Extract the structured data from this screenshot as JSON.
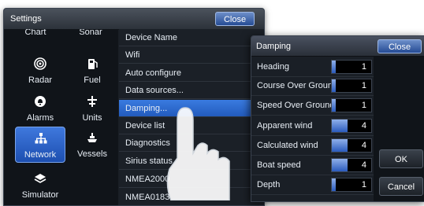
{
  "settings": {
    "title": "Settings",
    "close_label": "Close",
    "categories": [
      {
        "label": "Chart",
        "icon": "chart-icon"
      },
      {
        "label": "Sonar",
        "icon": "sonar-icon"
      },
      {
        "label": "Radar",
        "icon": "radar-icon"
      },
      {
        "label": "Fuel",
        "icon": "fuel-icon"
      },
      {
        "label": "Alarms",
        "icon": "alarms-icon"
      },
      {
        "label": "Units",
        "icon": "units-icon"
      },
      {
        "label": "Network",
        "icon": "network-icon",
        "selected": true
      },
      {
        "label": "Vessels",
        "icon": "vessels-icon"
      },
      {
        "label": "Simulator",
        "icon": "simulator-icon"
      }
    ],
    "items": [
      "Device Name",
      "Wifi",
      "Auto configure",
      "Data sources...",
      "Damping...",
      "Device list",
      "Diagnostics",
      "Sirius status",
      "NMEA2000",
      "NMEA0183"
    ],
    "selected_item": "Damping..."
  },
  "damping": {
    "title": "Damping",
    "close_label": "Close",
    "rows": [
      {
        "label": "Heading",
        "value": "1",
        "level": 1
      },
      {
        "label": "Course Over Ground",
        "value": "1",
        "level": 1
      },
      {
        "label": "Speed Over Ground",
        "value": "1",
        "level": 1
      },
      {
        "label": "Apparent wind",
        "value": "4",
        "level": 4
      },
      {
        "label": "Calculated wind",
        "value": "4",
        "level": 4
      },
      {
        "label": "Boat speed",
        "value": "4",
        "level": 4
      },
      {
        "label": "Depth",
        "value": "1",
        "level": 1
      }
    ],
    "level_max": 10,
    "ok_label": "OK",
    "cancel_label": "Cancel"
  },
  "colors": {
    "accent": "#2a63c9",
    "title_bar": "#3a4049",
    "panel": "#1a1f26"
  }
}
